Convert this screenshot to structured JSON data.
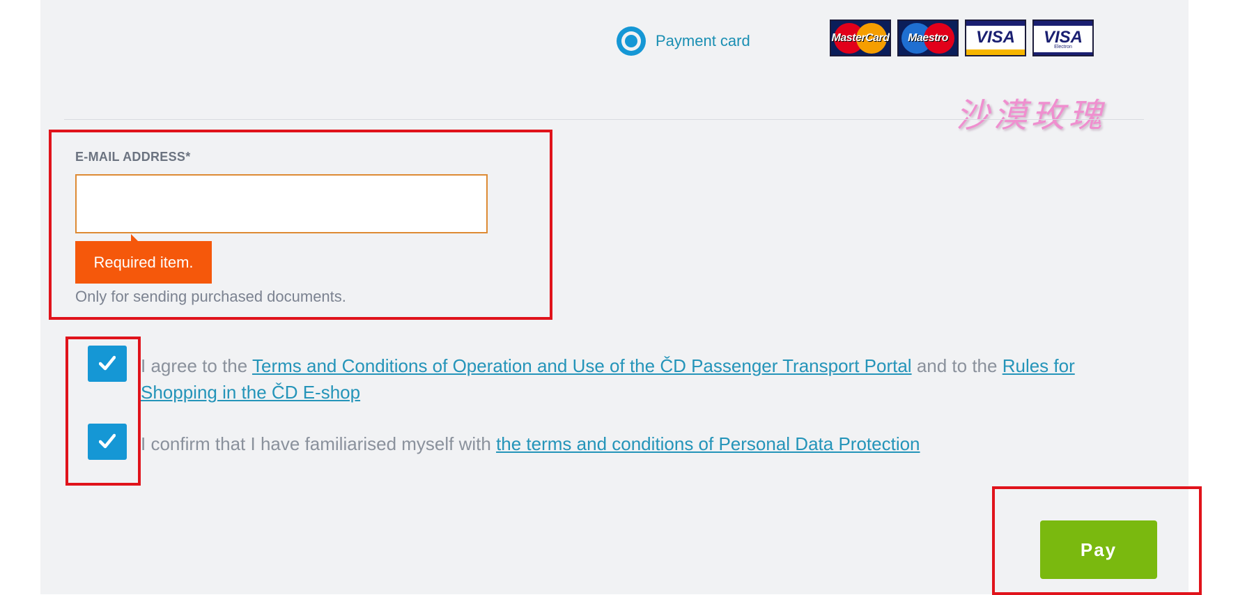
{
  "payment": {
    "option_label": "Payment card",
    "cards": [
      {
        "name": "MasterCard",
        "icon": "mastercard-logo"
      },
      {
        "name": "Maestro",
        "icon": "maestro-logo"
      },
      {
        "name": "VISA",
        "icon": "visa-logo"
      },
      {
        "name": "VISA",
        "sub": "Electron",
        "icon": "visa-electron-logo"
      }
    ]
  },
  "watermark": "沙漠玫瑰",
  "email": {
    "label": "E-MAIL ADDRESS*",
    "value": "",
    "error": "Required item.",
    "hint": "Only for sending purchased documents."
  },
  "consent": {
    "terms": {
      "prefix": "I agree to the ",
      "link1": "Terms and Conditions of Operation and Use of the ČD Passenger Transport Portal",
      "middle": " and to the ",
      "link2": "Rules for Shopping in the ČD E-shop",
      "checked": true
    },
    "privacy": {
      "prefix": "I confirm that I have familiarised myself with ",
      "link": "the terms and conditions of Personal Data Protection",
      "checked": true
    }
  },
  "pay_button": "Pay",
  "colors": {
    "accent_blue": "#1597d5",
    "link": "#2494b9",
    "error_orange": "#f5580b",
    "pay_green": "#7ab90f",
    "highlight_red": "#e0131b"
  }
}
